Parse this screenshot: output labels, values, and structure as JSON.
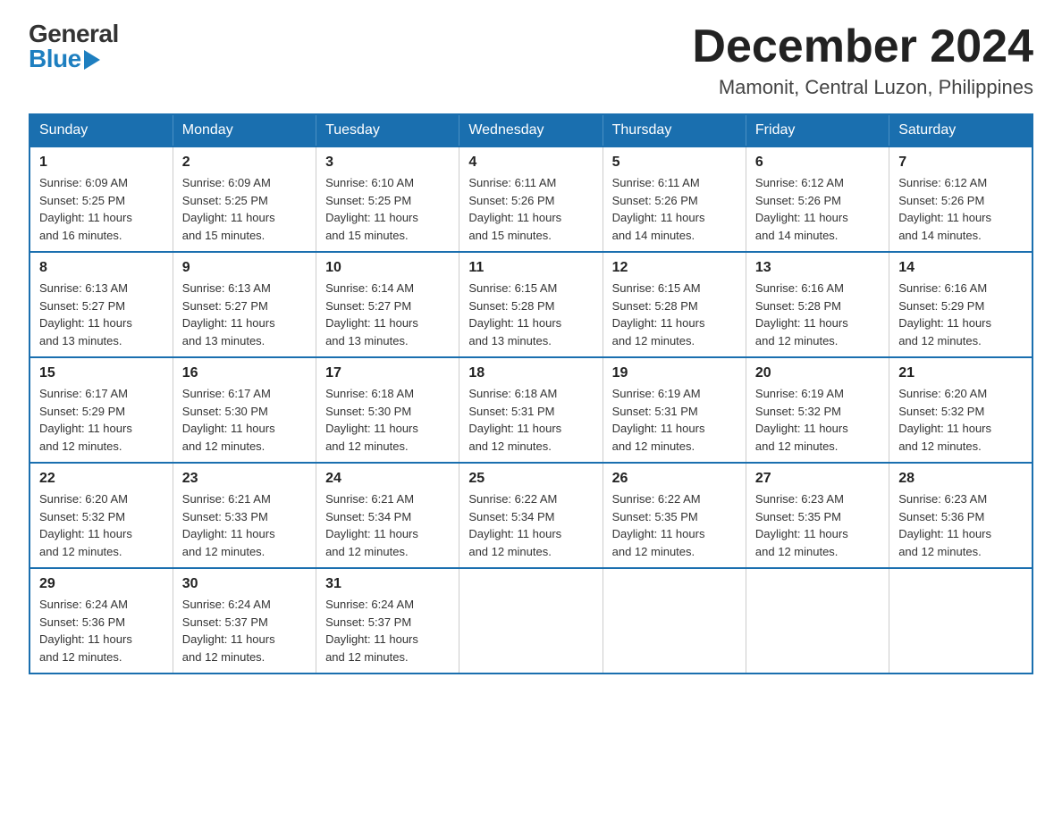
{
  "header": {
    "logo_general": "General",
    "logo_blue": "Blue",
    "month_title": "December 2024",
    "location": "Mamonit, Central Luzon, Philippines"
  },
  "days_of_week": [
    "Sunday",
    "Monday",
    "Tuesday",
    "Wednesday",
    "Thursday",
    "Friday",
    "Saturday"
  ],
  "weeks": [
    [
      {
        "day": "1",
        "sunrise": "6:09 AM",
        "sunset": "5:25 PM",
        "daylight": "11 hours and 16 minutes."
      },
      {
        "day": "2",
        "sunrise": "6:09 AM",
        "sunset": "5:25 PM",
        "daylight": "11 hours and 15 minutes."
      },
      {
        "day": "3",
        "sunrise": "6:10 AM",
        "sunset": "5:25 PM",
        "daylight": "11 hours and 15 minutes."
      },
      {
        "day": "4",
        "sunrise": "6:11 AM",
        "sunset": "5:26 PM",
        "daylight": "11 hours and 15 minutes."
      },
      {
        "day": "5",
        "sunrise": "6:11 AM",
        "sunset": "5:26 PM",
        "daylight": "11 hours and 14 minutes."
      },
      {
        "day": "6",
        "sunrise": "6:12 AM",
        "sunset": "5:26 PM",
        "daylight": "11 hours and 14 minutes."
      },
      {
        "day": "7",
        "sunrise": "6:12 AM",
        "sunset": "5:26 PM",
        "daylight": "11 hours and 14 minutes."
      }
    ],
    [
      {
        "day": "8",
        "sunrise": "6:13 AM",
        "sunset": "5:27 PM",
        "daylight": "11 hours and 13 minutes."
      },
      {
        "day": "9",
        "sunrise": "6:13 AM",
        "sunset": "5:27 PM",
        "daylight": "11 hours and 13 minutes."
      },
      {
        "day": "10",
        "sunrise": "6:14 AM",
        "sunset": "5:27 PM",
        "daylight": "11 hours and 13 minutes."
      },
      {
        "day": "11",
        "sunrise": "6:15 AM",
        "sunset": "5:28 PM",
        "daylight": "11 hours and 13 minutes."
      },
      {
        "day": "12",
        "sunrise": "6:15 AM",
        "sunset": "5:28 PM",
        "daylight": "11 hours and 12 minutes."
      },
      {
        "day": "13",
        "sunrise": "6:16 AM",
        "sunset": "5:28 PM",
        "daylight": "11 hours and 12 minutes."
      },
      {
        "day": "14",
        "sunrise": "6:16 AM",
        "sunset": "5:29 PM",
        "daylight": "11 hours and 12 minutes."
      }
    ],
    [
      {
        "day": "15",
        "sunrise": "6:17 AM",
        "sunset": "5:29 PM",
        "daylight": "11 hours and 12 minutes."
      },
      {
        "day": "16",
        "sunrise": "6:17 AM",
        "sunset": "5:30 PM",
        "daylight": "11 hours and 12 minutes."
      },
      {
        "day": "17",
        "sunrise": "6:18 AM",
        "sunset": "5:30 PM",
        "daylight": "11 hours and 12 minutes."
      },
      {
        "day": "18",
        "sunrise": "6:18 AM",
        "sunset": "5:31 PM",
        "daylight": "11 hours and 12 minutes."
      },
      {
        "day": "19",
        "sunrise": "6:19 AM",
        "sunset": "5:31 PM",
        "daylight": "11 hours and 12 minutes."
      },
      {
        "day": "20",
        "sunrise": "6:19 AM",
        "sunset": "5:32 PM",
        "daylight": "11 hours and 12 minutes."
      },
      {
        "day": "21",
        "sunrise": "6:20 AM",
        "sunset": "5:32 PM",
        "daylight": "11 hours and 12 minutes."
      }
    ],
    [
      {
        "day": "22",
        "sunrise": "6:20 AM",
        "sunset": "5:32 PM",
        "daylight": "11 hours and 12 minutes."
      },
      {
        "day": "23",
        "sunrise": "6:21 AM",
        "sunset": "5:33 PM",
        "daylight": "11 hours and 12 minutes."
      },
      {
        "day": "24",
        "sunrise": "6:21 AM",
        "sunset": "5:34 PM",
        "daylight": "11 hours and 12 minutes."
      },
      {
        "day": "25",
        "sunrise": "6:22 AM",
        "sunset": "5:34 PM",
        "daylight": "11 hours and 12 minutes."
      },
      {
        "day": "26",
        "sunrise": "6:22 AM",
        "sunset": "5:35 PM",
        "daylight": "11 hours and 12 minutes."
      },
      {
        "day": "27",
        "sunrise": "6:23 AM",
        "sunset": "5:35 PM",
        "daylight": "11 hours and 12 minutes."
      },
      {
        "day": "28",
        "sunrise": "6:23 AM",
        "sunset": "5:36 PM",
        "daylight": "11 hours and 12 minutes."
      }
    ],
    [
      {
        "day": "29",
        "sunrise": "6:24 AM",
        "sunset": "5:36 PM",
        "daylight": "11 hours and 12 minutes."
      },
      {
        "day": "30",
        "sunrise": "6:24 AM",
        "sunset": "5:37 PM",
        "daylight": "11 hours and 12 minutes."
      },
      {
        "day": "31",
        "sunrise": "6:24 AM",
        "sunset": "5:37 PM",
        "daylight": "11 hours and 12 minutes."
      },
      null,
      null,
      null,
      null
    ]
  ],
  "labels": {
    "sunrise": "Sunrise:",
    "sunset": "Sunset:",
    "daylight": "Daylight:"
  }
}
